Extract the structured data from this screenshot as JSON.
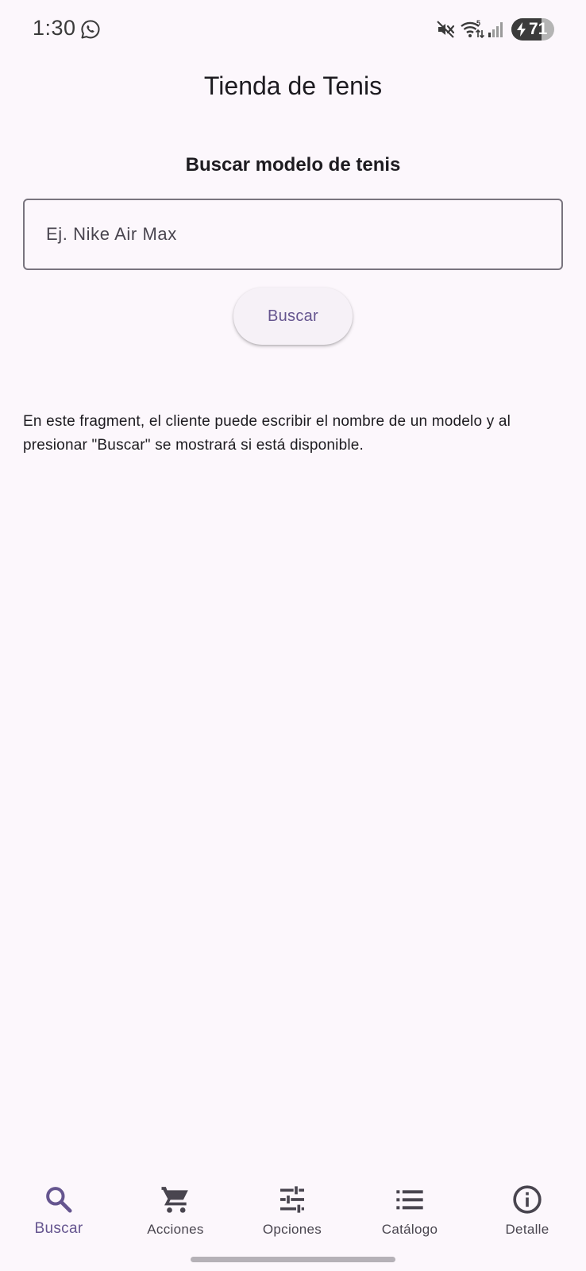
{
  "status_bar": {
    "time": "1:30",
    "battery_level": "71",
    "battery_fraction": 0.71,
    "icons": [
      "whatsapp-icon",
      "mute-icon",
      "wifi-icon",
      "signal-icon",
      "battery-charging-icon"
    ]
  },
  "app_bar": {
    "title": "Tienda de Tenis"
  },
  "search": {
    "section_title": "Buscar modelo de tenis",
    "placeholder": "Ej. Nike Air Max",
    "value": "",
    "button_label": "Buscar"
  },
  "description": "En este fragment, el cliente puede escribir el nombre de un modelo y al presionar \"Buscar\" se mostrará si está disponible.",
  "bottom_nav": {
    "items": [
      {
        "label": "Buscar",
        "icon": "search-icon",
        "active": true
      },
      {
        "label": "Acciones",
        "icon": "cart-icon",
        "active": false
      },
      {
        "label": "Opciones",
        "icon": "tune-icon",
        "active": false
      },
      {
        "label": "Catálogo",
        "icon": "list-icon",
        "active": false
      },
      {
        "label": "Detalle",
        "icon": "info-icon",
        "active": false
      }
    ]
  },
  "colors": {
    "background": "#fcf7fc",
    "accent": "#65558f",
    "inactive": "#49454f",
    "outline": "#79747e"
  }
}
